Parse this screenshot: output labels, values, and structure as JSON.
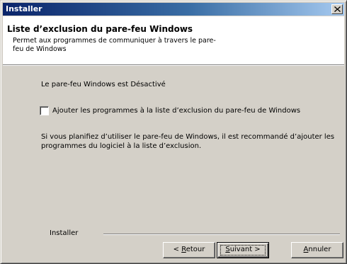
{
  "window": {
    "title": "Installer",
    "close_icon": "close-icon"
  },
  "header": {
    "title": "Liste d’exclusion du pare-feu Windows",
    "subtitle": "Permet aux programmes de communiquer à travers le pare-feu de Windows"
  },
  "content": {
    "status": "Le pare-feu Windows est Désactivé",
    "checkbox": {
      "label": "Ajouter les programmes à la liste d’exclusion du pare-feu de Windows",
      "checked": false
    },
    "info": "Si vous planifiez d’utiliser le pare-feu de Windows, il est recommandé d’ajouter les programmes du logiciel à la liste d’exclusion."
  },
  "footer": {
    "group_label": "Installer",
    "back_label_prefix": "< ",
    "back_label_accel": "R",
    "back_label_rest": "etour",
    "next_label_accel": "S",
    "next_label_rest": "uivant >",
    "cancel_label_accel": "A",
    "cancel_label_rest": "nnuler"
  }
}
